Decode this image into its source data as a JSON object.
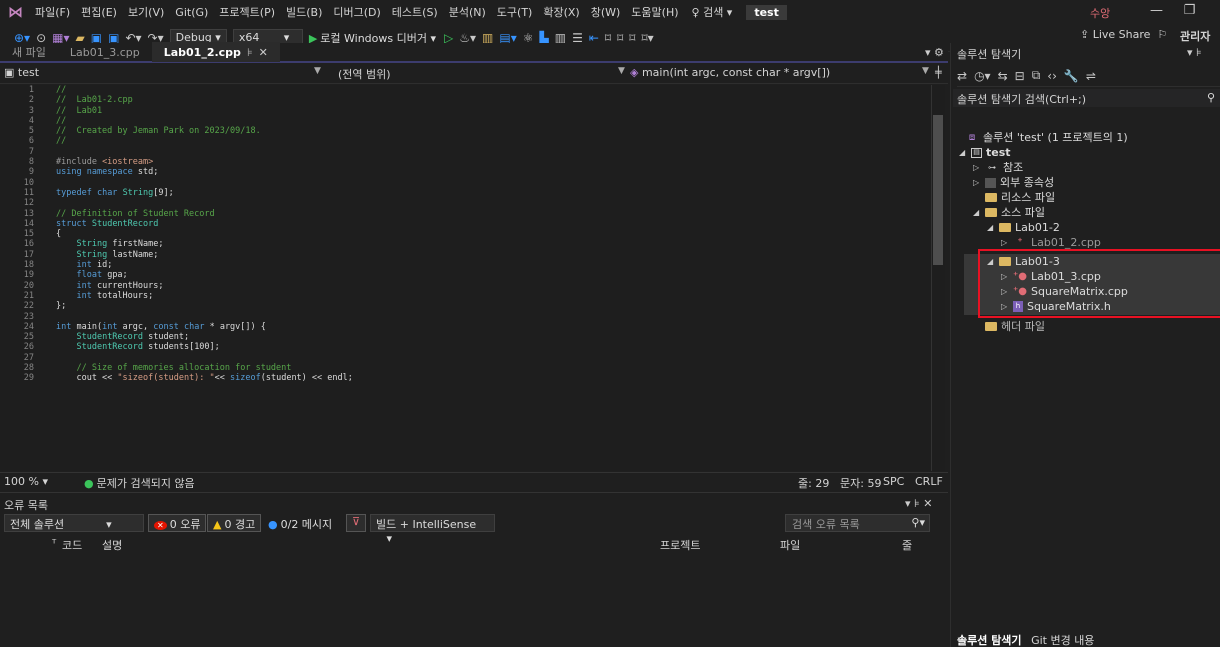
{
  "menu": {
    "items": [
      "파일(F)",
      "편집(E)",
      "보기(V)",
      "Git(G)",
      "프로젝트(P)",
      "빌드(B)",
      "디버그(D)",
      "테스트(S)",
      "분석(N)",
      "도구(T)",
      "확장(X)",
      "창(W)",
      "도움말(H)"
    ],
    "search": "♀ 검색 ▾",
    "project": "test",
    "user": "수앙"
  },
  "toolbar": {
    "config": "Debug",
    "platform": "x64",
    "run": "로컬 Windows 디버거",
    "live_share": "Live Share",
    "admin": "관리자"
  },
  "editor_tabs": {
    "new_file": "새 파일",
    "tab1": "Lab01_3.cpp",
    "tab2": "Lab01_2.cpp"
  },
  "navbar": {
    "project": "test",
    "scope": "(전역 범위)",
    "member": "main(int argc, const char * argv[])"
  },
  "code_lines": [
    {
      "n": "1",
      "t": "//"
    },
    {
      "n": "2",
      "t": "//  Lab01-2.cpp"
    },
    {
      "n": "3",
      "t": "//  Lab01"
    },
    {
      "n": "4",
      "t": "//"
    },
    {
      "n": "5",
      "t": "//  Created by Jeman Park on 2023/09/18."
    },
    {
      "n": "6",
      "t": "//"
    },
    {
      "n": "7",
      "t": ""
    },
    {
      "n": "8",
      "t": "#include <iostream>"
    },
    {
      "n": "9",
      "t": "using namespace std;"
    },
    {
      "n": "10",
      "t": ""
    },
    {
      "n": "11",
      "t": "typedef char String[9];"
    },
    {
      "n": "12",
      "t": ""
    },
    {
      "n": "13",
      "t": "// Definition of Student Record"
    },
    {
      "n": "14",
      "t": "struct StudentRecord"
    },
    {
      "n": "15",
      "t": "{"
    },
    {
      "n": "16",
      "t": "    String firstName;"
    },
    {
      "n": "17",
      "t": "    String lastName;"
    },
    {
      "n": "18",
      "t": "    int id;"
    },
    {
      "n": "19",
      "t": "    float gpa;"
    },
    {
      "n": "20",
      "t": "    int currentHours;"
    },
    {
      "n": "21",
      "t": "    int totalHours;"
    },
    {
      "n": "22",
      "t": "};"
    },
    {
      "n": "23",
      "t": ""
    },
    {
      "n": "24",
      "t": "int main(int argc, const char * argv[]) {"
    },
    {
      "n": "25",
      "t": "    StudentRecord student;"
    },
    {
      "n": "26",
      "t": "    StudentRecord students[100];"
    },
    {
      "n": "27",
      "t": ""
    },
    {
      "n": "28",
      "t": "    // Size of memories allocation for student"
    },
    {
      "n": "29",
      "t": "    cout << \"sizeof(student): \"<< sizeof(student) << endl;"
    }
  ],
  "editor_status": {
    "zoom": "100 %",
    "issues": "문제가 검색되지 않음",
    "line": "줄: 29",
    "col": "문자: 59",
    "spc": "SPC",
    "crlf": "CRLF"
  },
  "error_list": {
    "title": "오류 목록",
    "scope": "전체 솔루션",
    "errors": "0 오류",
    "warnings": "0 경고",
    "messages": "0/2 메시지",
    "source": "빌드 + IntelliSense",
    "search_placeholder": "검색 오류 목록",
    "col_code": "코드",
    "col_desc": "설명",
    "col_project": "프로젝트",
    "col_file": "파일",
    "col_line": "줄"
  },
  "solution_explorer": {
    "title": "솔루션 탐색기",
    "search": "솔루션 탐색기 검색(Ctrl+;)",
    "solution": "솔루션 'test' (1 프로젝트의 1)",
    "project": "test",
    "refs": "참조",
    "ext_deps": "외부 종속성",
    "resources": "리소스 파일",
    "sources": "소스 파일",
    "lab012": "Lab01-2",
    "lab012_file": "Lab01_2.cpp",
    "lab013": "Lab01-3",
    "f1": "Lab01_3.cpp",
    "f2": "SquareMatrix.cpp",
    "f3": "SquareMatrix.h",
    "headers": "헤더 파일",
    "bottom_tab1": "솔루션 탐색기",
    "bottom_tab2": "Git 변경 내용"
  },
  "colors": {
    "accent": "#3794ff",
    "highlight_box": "#e81123",
    "comment": "#57a64a",
    "keyword": "#569cd6",
    "type": "#4ec9b0"
  }
}
